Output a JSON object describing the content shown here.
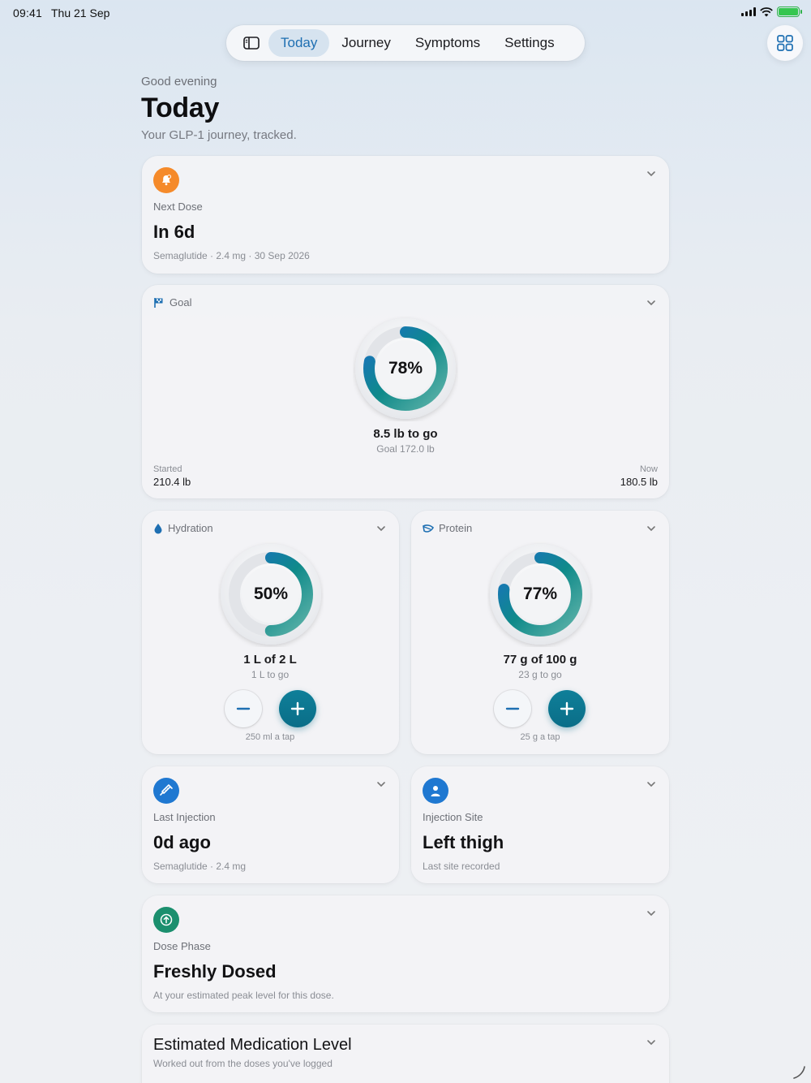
{
  "status_bar": {
    "time": "09:41",
    "date": "Thu 21 Sep"
  },
  "nav": {
    "tabs": [
      {
        "label": "Today",
        "active": true
      },
      {
        "label": "Journey",
        "active": false
      },
      {
        "label": "Symptoms",
        "active": false
      },
      {
        "label": "Settings",
        "active": false
      }
    ],
    "sidebar_icon": "sidebar-toggle-icon",
    "grid_icon": "grid-icon"
  },
  "header": {
    "greeting": "Good evening",
    "title": "Today",
    "subtitle": "Your GLP-1 journey, tracked."
  },
  "next_dose": {
    "icon": "bell-icon",
    "label": "Next Dose",
    "value": "In 6d",
    "detail": "Semaglutide · 2.4 mg · 30 Sep 2026",
    "accent": "#f58a2a"
  },
  "goal": {
    "icon": "flag-icon",
    "label": "Goal",
    "progress": 0.78,
    "percent_text": "78%",
    "to_go": "8.5 lb to go",
    "goal_text": "Goal 172.0 lb",
    "started_label": "Started",
    "started_value": "210.4 lb",
    "now_label": "Now",
    "now_value": "180.5 lb"
  },
  "hydration": {
    "icon": "water-drop-icon",
    "label": "Hydration",
    "progress": 0.5,
    "percent_text": "50%",
    "amount": "1 L of 2 L",
    "remaining": "1 L to go",
    "tap_text": "250 ml a tap"
  },
  "protein": {
    "icon": "leaf-icon",
    "label": "Protein",
    "progress": 0.77,
    "percent_text": "77%",
    "amount": "77 g of 100 g",
    "remaining": "23 g to go",
    "tap_text": "25 g a tap"
  },
  "last_injection": {
    "icon": "syringe-icon",
    "label": "Last Injection",
    "value": "0d ago",
    "detail": "Semaglutide · 2.4 mg",
    "accent": "#1f78d1"
  },
  "injection_site": {
    "icon": "person-icon",
    "label": "Injection Site",
    "value": "Left thigh",
    "detail": "Last site recorded",
    "accent": "#1f78d1"
  },
  "dose_phase": {
    "icon": "arrow-up-circle-icon",
    "label": "Dose Phase",
    "value": "Freshly Dosed",
    "detail": "At your estimated peak level for this dose.",
    "accent": "#1b8f6e"
  },
  "medication_level": {
    "title": "Estimated Medication Level",
    "subtitle": "Worked out from the doses you've logged"
  },
  "colors": {
    "ring_start": "#5fb3a9",
    "ring_mid": "#0f8a8a",
    "ring_end": "#1a6fc4",
    "accent_blue": "#1e6fb2"
  }
}
